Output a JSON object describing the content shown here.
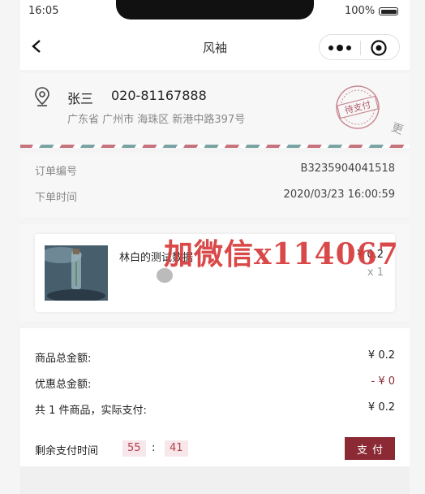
{
  "status_bar": {
    "time": "16:05",
    "battery": "100%"
  },
  "nav": {
    "title": "风袖",
    "back_icon": "chevron-left-icon",
    "more_icon": "more-dots-icon",
    "target_icon": "target-circle-icon"
  },
  "address": {
    "name": "张三",
    "phone": "020-81167888",
    "detail": "广东省 广州市 海珠区 新港中路397号",
    "stamp_text": "待支付",
    "icon": "location-pin-icon"
  },
  "order": {
    "number_label": "订单编号",
    "number_value": "B3235904041518",
    "time_label": "下单时间",
    "time_value": "2020/03/23 16:00:59"
  },
  "product": {
    "name": "林白的测试数据",
    "price": "¥ 0.2",
    "quantity": "x 1"
  },
  "summary": {
    "total_label": "商品总金额:",
    "total_value": "¥ 0.2",
    "discount_label": "优惠总金额:",
    "discount_value": "- ¥ 0",
    "pay_label": "共 1 件商品，实际支付:",
    "pay_value": "¥ 0.2",
    "countdown_label": "剩余支付时间",
    "minutes": "55",
    "separator": ":",
    "seconds": "41",
    "pay_button": "支付"
  },
  "watermark": "加微信x114067",
  "side_mark": "更",
  "colors": {
    "accent": "#8b2a35",
    "stamp": "#b05a66",
    "countdown_bg": "#f8e7ea",
    "watermark": "#d73a3a"
  }
}
